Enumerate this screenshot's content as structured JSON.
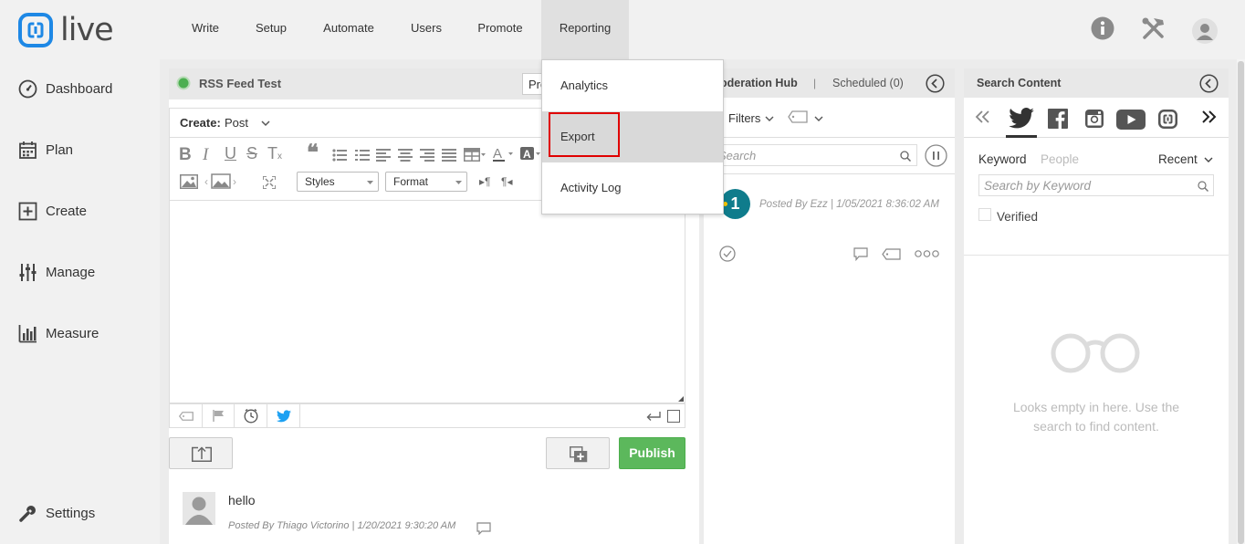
{
  "app": {
    "logo_text": "live"
  },
  "nav": {
    "items": [
      "Write",
      "Setup",
      "Automate",
      "Users",
      "Promote",
      "Reporting"
    ],
    "active": "Reporting"
  },
  "reporting_menu": {
    "items": [
      "Analytics",
      "Export",
      "Activity Log"
    ],
    "highlighted": "Export"
  },
  "sidebar": {
    "items": [
      "Dashboard",
      "Plan",
      "Create",
      "Manage",
      "Measure"
    ],
    "settings": "Settings"
  },
  "composer": {
    "feed_name": "RSS Feed Test",
    "profile_partial": "Pro",
    "create_label": "Create:",
    "create_value": "Post",
    "styles_label": "Styles",
    "format_label": "Format",
    "publish_label": "Publish"
  },
  "recent_post": {
    "text": "hello",
    "meta": "Posted By Thiago Victorino | 1/20/2021 9:30:20 AM"
  },
  "moderation": {
    "title_partial": "oderation Hub",
    "separator": "|",
    "scheduled": "Scheduled (0)",
    "filters_label": "Filters",
    "search_placeholder_partial": "Search",
    "avatar_text": "1",
    "post_meta": "Posted By Ezz | 1/05/2021 8:36:02 AM"
  },
  "search_content": {
    "title": "Search Content",
    "tab_keyword": "Keyword",
    "tab_people": "People",
    "sort": "Recent",
    "keyword_placeholder": "Search by Keyword",
    "verified_label": "Verified",
    "empty_message": "Looks empty in here. Use the search to find content."
  },
  "colors": {
    "accent_blue": "#1e88e5",
    "publish_green": "#5cb85c",
    "status_green": "#4caf50",
    "highlight_red": "#e00000",
    "twitter_blue": "#1da1f2",
    "avatar_teal": "#0f7c8c"
  }
}
